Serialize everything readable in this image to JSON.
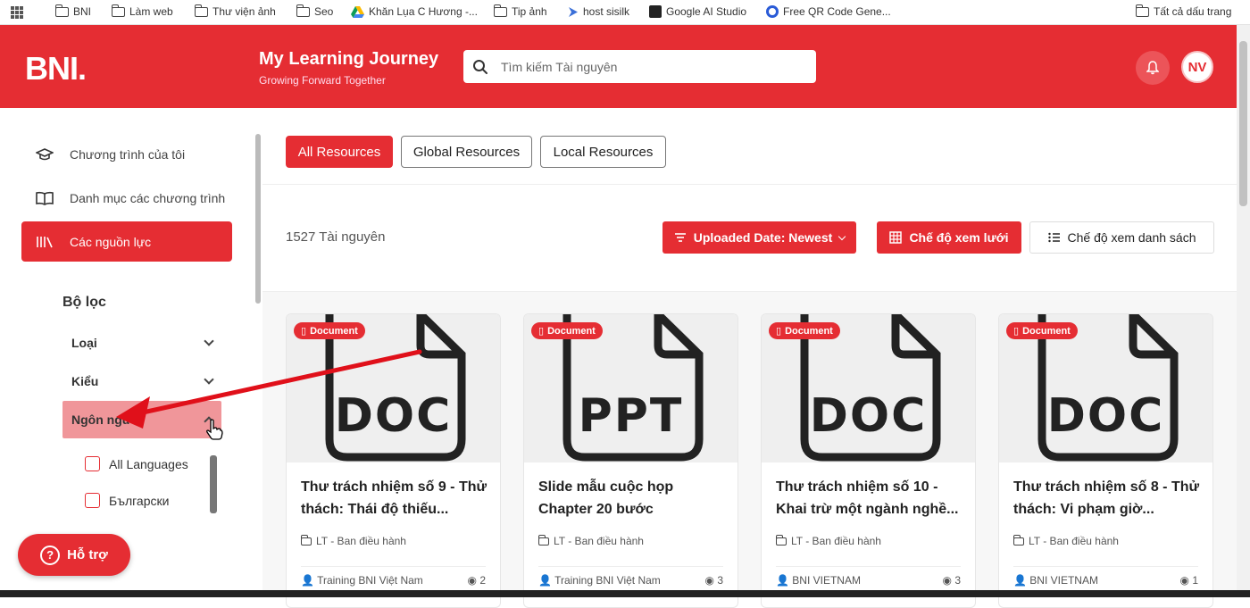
{
  "bookmarks": [
    {
      "label": "BNI",
      "icon": "folder-icon"
    },
    {
      "label": "Làm web",
      "icon": "folder-icon"
    },
    {
      "label": "Thư viện ảnh",
      "icon": "folder-icon"
    },
    {
      "label": "Seo",
      "icon": "folder-icon"
    },
    {
      "label": "Khăn Lụa C Hương -...",
      "icon": "drive-icon"
    },
    {
      "label": "Tip ảnh",
      "icon": "folder-icon"
    },
    {
      "label": "host sisilk",
      "icon": "link-icon"
    },
    {
      "label": "Google AI Studio",
      "icon": "studio-icon"
    },
    {
      "label": "Free QR Code Gene...",
      "icon": "qr-icon"
    },
    {
      "label": "Tất cả dấu trang",
      "icon": "folder-icon"
    }
  ],
  "header": {
    "logo": "BNI.",
    "title": "My Learning Journey",
    "subtitle": "Growing Forward Together",
    "search_placeholder": "Tìm kiếm Tài nguyên",
    "avatar_initials": "NV",
    "brand_color": "#e52d33"
  },
  "sidebar": {
    "items": [
      {
        "label": "Chương trình của tôi",
        "icon": "graduation-cap-icon"
      },
      {
        "label": "Danh mục các chương trình",
        "icon": "book-icon"
      },
      {
        "label": "Các nguồn lực",
        "icon": "library-icon"
      }
    ],
    "filter_title": "Bộ lọc",
    "filters": [
      {
        "label": "Loại"
      },
      {
        "label": "Kiểu"
      },
      {
        "label": "Ngôn ngữ"
      }
    ],
    "languages": [
      {
        "label": "All Languages"
      },
      {
        "label": "Български"
      }
    ],
    "help_label": "Hỗ trợ"
  },
  "tabs": [
    {
      "label": "All Resources"
    },
    {
      "label": "Global Resources"
    },
    {
      "label": "Local Resources"
    }
  ],
  "toolbar": {
    "count": "1527 Tài nguyên",
    "sort_label": "Uploaded Date: Newest",
    "grid_label": "Chế độ xem lưới",
    "list_label": "Chế độ xem danh sách"
  },
  "cards": [
    {
      "badge": "Document",
      "file_type": "DOC",
      "title": "Thư trách nhiệm số 9 - Thử thách: Thái độ thiếu...",
      "category": "LT - Ban điều hành",
      "author": "Training BNI Việt Nam",
      "views": "2"
    },
    {
      "badge": "Document",
      "file_type": "PPT",
      "title": "Slide mẫu cuộc họp Chapter 20 bước",
      "category": "LT - Ban điều hành",
      "author": "Training BNI Việt Nam",
      "views": "3"
    },
    {
      "badge": "Document",
      "file_type": "DOC",
      "title": "Thư trách nhiệm số 10 - Khai trừ một ngành nghề...",
      "category": "LT - Ban điều hành",
      "author": "BNI VIETNAM",
      "views": "3"
    },
    {
      "badge": "Document",
      "file_type": "DOC",
      "title": "Thư trách nhiệm số 8 - Thử thách: Vi phạm giờ...",
      "category": "LT - Ban điều hành",
      "author": "BNI VIETNAM",
      "views": "1"
    }
  ]
}
